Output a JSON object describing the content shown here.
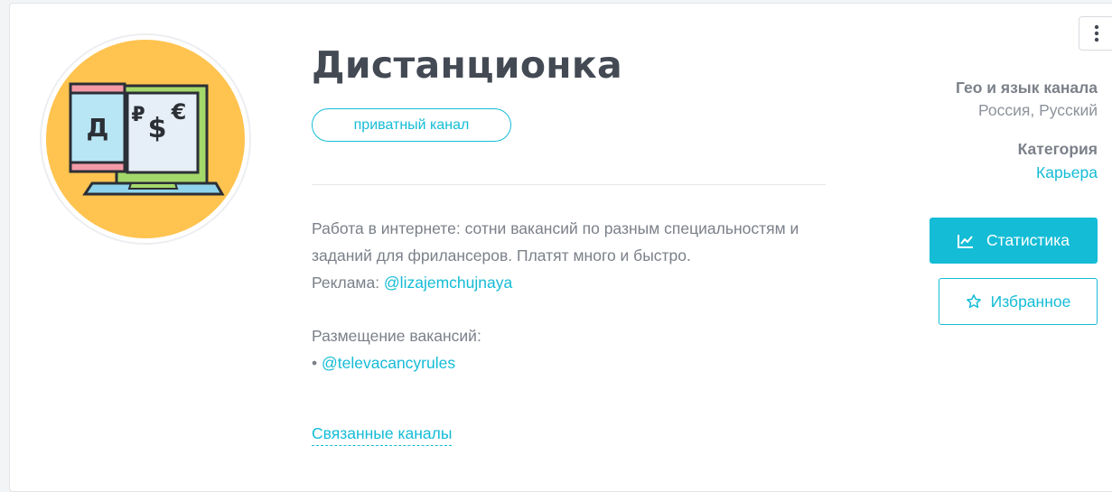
{
  "channel": {
    "title": "Дистанционка",
    "badge": "приватный канал",
    "description_lines": [
      "Работа в интернете: сотни вакансий по разным специальностям и заданий для фрилансеров. Платят много и быстро."
    ],
    "ad_prefix": "Реклама: ",
    "ad_contact": "@lizajemchujnaya",
    "vacancies_label": "Размещение вакансий:",
    "vacancies_bullet": "• ",
    "vacancies_contact": "@televacancyrules",
    "related_link": "Связанные каналы"
  },
  "avatar": {
    "letter": "Д",
    "symbols": [
      "₽",
      "$",
      "€"
    ]
  },
  "sidebar": {
    "geo_label": "Гео и язык канала",
    "geo_value": "Россия, Русский",
    "category_label": "Категория",
    "category_value": "Карьера",
    "stats_button": "Статистика",
    "favorite_button": "Избранное"
  },
  "icons": {
    "stats": "line-chart-icon",
    "favorite": "star-outline-icon",
    "menu": "vertical-dots-icon"
  },
  "colors": {
    "accent": "#14bcd6",
    "title": "#434a54",
    "text": "#7b8089",
    "avatar_bg": "#ffc34f"
  }
}
